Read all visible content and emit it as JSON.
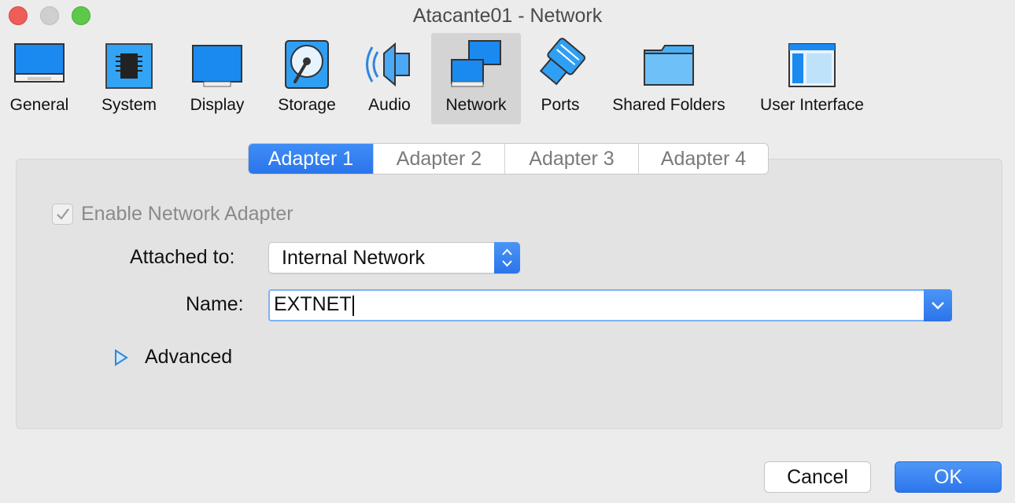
{
  "window": {
    "title": "Atacante01 - Network"
  },
  "toolbar": {
    "items": [
      {
        "label": "General",
        "icon": "general-icon"
      },
      {
        "label": "System",
        "icon": "system-icon"
      },
      {
        "label": "Display",
        "icon": "display-icon"
      },
      {
        "label": "Storage",
        "icon": "storage-icon"
      },
      {
        "label": "Audio",
        "icon": "audio-icon"
      },
      {
        "label": "Network",
        "icon": "network-icon",
        "selected": true
      },
      {
        "label": "Ports",
        "icon": "ports-icon"
      },
      {
        "label": "Shared Folders",
        "icon": "shared-folders-icon"
      },
      {
        "label": "User Interface",
        "icon": "user-interface-icon"
      }
    ]
  },
  "tabs": [
    {
      "label": "Adapter 1",
      "active": true
    },
    {
      "label": "Adapter 2"
    },
    {
      "label": "Adapter 3"
    },
    {
      "label": "Adapter 4"
    }
  ],
  "form": {
    "enable_label": "Enable Network Adapter",
    "enable_checked": true,
    "attached_label": "Attached to:",
    "attached_value": "Internal Network",
    "name_label": "Name:",
    "name_value": "EXTNET",
    "advanced_label": "Advanced"
  },
  "buttons": {
    "cancel": "Cancel",
    "ok": "OK"
  },
  "colors": {
    "accent": "#2a75ec",
    "window_bg": "#ececec",
    "panel_bg": "#e3e3e3"
  }
}
